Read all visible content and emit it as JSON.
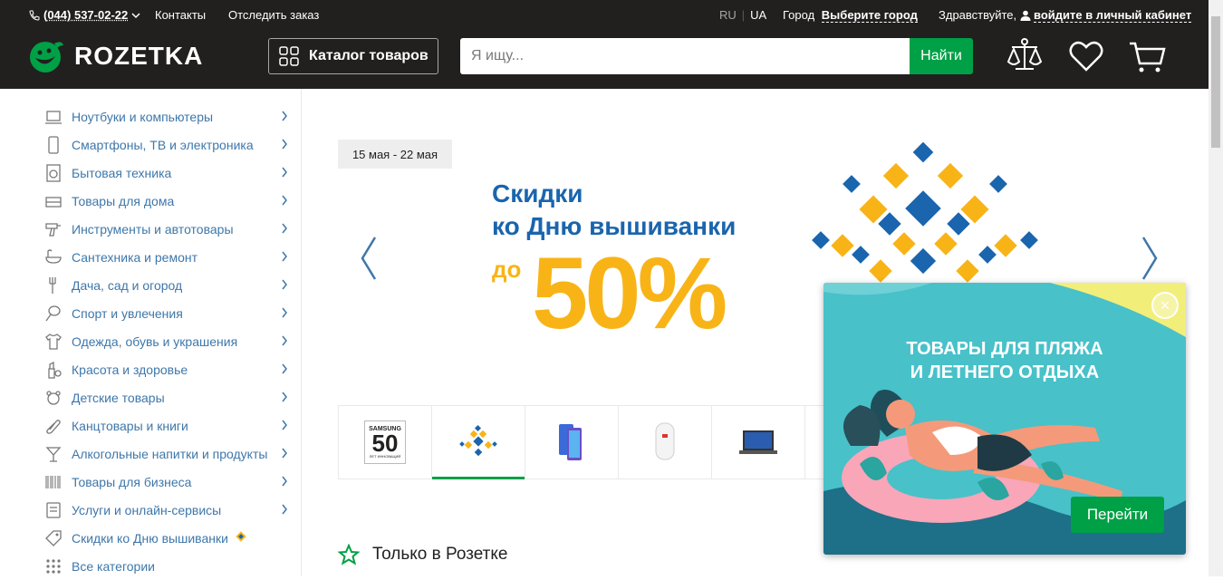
{
  "topbar": {
    "phone": "(044) 537-02-22",
    "contacts": "Контакты",
    "track_order": "Отследить заказ",
    "lang_ru": "RU",
    "lang_ua": "UA",
    "city_label": "Город",
    "city_value": "Выберите город",
    "greeting": "Здравствуйте,",
    "login": "войдите в личный кабинет"
  },
  "header": {
    "logo_text": "ROZETKA",
    "catalog_label": "Каталог товаров",
    "search_placeholder": "Я ищу...",
    "search_button": "Найти"
  },
  "sidebar": {
    "items": [
      {
        "label": "Ноутбуки и компьютеры",
        "icon": "laptop-icon"
      },
      {
        "label": "Смартфоны, ТВ и электроника",
        "icon": "smartphone-icon"
      },
      {
        "label": "Бытовая техника",
        "icon": "washing-machine-icon"
      },
      {
        "label": "Товары для дома",
        "icon": "furniture-icon"
      },
      {
        "label": "Инструменты и автотовары",
        "icon": "drill-icon"
      },
      {
        "label": "Сантехника и ремонт",
        "icon": "bathtub-icon"
      },
      {
        "label": "Дача, сад и огород",
        "icon": "garden-fork-icon"
      },
      {
        "label": "Спорт и увлечения",
        "icon": "racket-icon"
      },
      {
        "label": "Одежда, обувь и украшения",
        "icon": "tshirt-icon"
      },
      {
        "label": "Красота и здоровье",
        "icon": "cosmetics-icon"
      },
      {
        "label": "Детские товары",
        "icon": "teddy-bear-icon"
      },
      {
        "label": "Канцтовары и книги",
        "icon": "paperclip-icon"
      },
      {
        "label": "Алкогольные напитки и продукты",
        "icon": "cocktail-icon"
      },
      {
        "label": "Товары для бизнеса",
        "icon": "barcode-icon"
      },
      {
        "label": "Услуги и онлайн-сервисы",
        "icon": "services-icon"
      },
      {
        "label": "Скидки ко Дню вышиванки",
        "icon": "tag-icon"
      },
      {
        "label": "Все категории",
        "icon": "grid-icon"
      }
    ]
  },
  "banner": {
    "dates": "15 мая - 22 мая",
    "line1": "Скидки",
    "line2": "ко Дню вышиванки",
    "prefix": "до",
    "percent": "50%"
  },
  "thumbs": [
    {
      "label": "SAMSUNG",
      "big": "50",
      "small": "ЛЕТ ИННОВАЦИЙ"
    },
    {
      "label": "embroidery"
    },
    {
      "label": "phones"
    },
    {
      "label": "boiler"
    },
    {
      "label": "laptop"
    },
    {
      "label": ""
    }
  ],
  "section": {
    "only_title": "Только в Розетке"
  },
  "popup": {
    "title_line1": "ТОВАРЫ ДЛЯ ПЛЯЖА",
    "title_line2": "И ЛЕТНЕГО ОТДЫХА",
    "button": "Перейти",
    "close": "×"
  },
  "colors": {
    "header_bg": "#221f1f",
    "accent_green": "#00a046",
    "link_blue": "#3e77aa",
    "banner_blue": "#1a65ad",
    "banner_yellow": "#f8b417",
    "popup_bg": "#48c1c9"
  }
}
